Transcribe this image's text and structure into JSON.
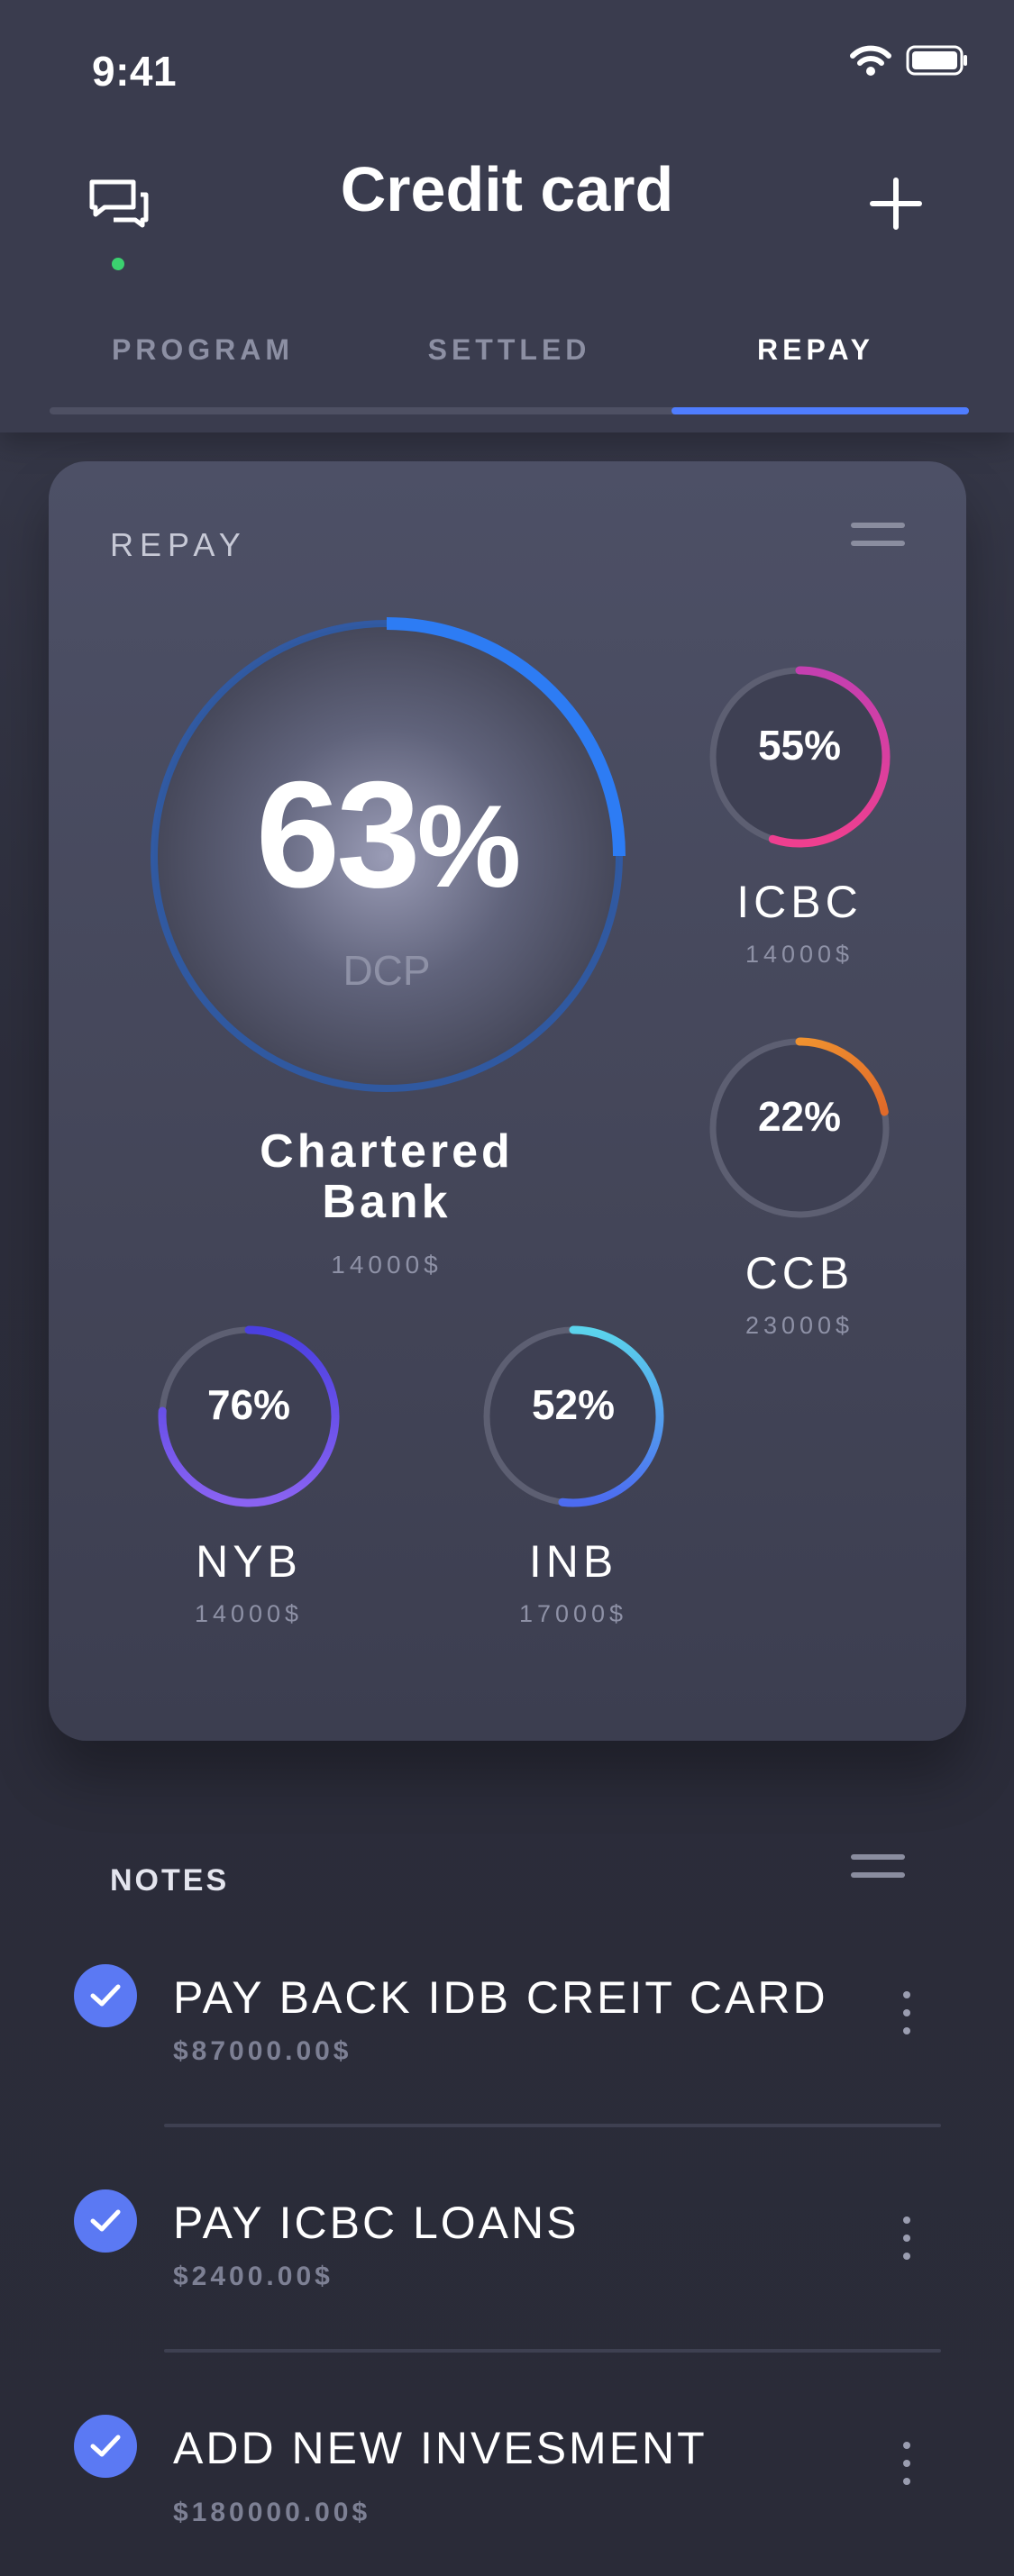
{
  "status_bar": {
    "time": "9:41"
  },
  "header": {
    "title": "Credit card"
  },
  "tabs": [
    {
      "label": "PROGRAM",
      "active": false
    },
    {
      "label": "SETTLED",
      "active": false
    },
    {
      "label": "REPAY",
      "active": true
    }
  ],
  "card": {
    "title": "REPAY",
    "main": {
      "value": "63",
      "unit": "%",
      "label": "DCP",
      "bank": "Chartered Bank",
      "bank_line1": "Chartered",
      "bank_line2": "Bank",
      "amount": "14000$",
      "progress": 0.63,
      "color": "#2d7cf4"
    },
    "items": [
      {
        "value": "55%",
        "name": "ICBC",
        "amount": "14000$",
        "progress": 0.55,
        "color_start": "#c43fb0",
        "color_end": "#ee3f8f"
      },
      {
        "value": "22%",
        "name": "CCB",
        "amount": "23000$",
        "progress": 0.22,
        "color_start": "#f0922f",
        "color_end": "#e06a2a"
      },
      {
        "value": "76%",
        "name": "NYB",
        "amount": "14000$",
        "progress": 0.76,
        "color_start": "#4a3fe0",
        "color_end": "#8a63f2"
      },
      {
        "value": "52%",
        "name": "INB",
        "amount": "17000$",
        "progress": 0.52,
        "color_start": "#5bd4ec",
        "color_end": "#4c6bf0"
      }
    ]
  },
  "notes": {
    "title": "NOTES",
    "items": [
      {
        "title": "PAY BACK IDB CREIT CARD",
        "amount": "$87000.00$"
      },
      {
        "title": "PAY ICBC LOANS",
        "amount": "$2400.00$"
      },
      {
        "title": "ADD NEW INVESMENT",
        "amount": "$180000.00$"
      }
    ]
  },
  "colors": {
    "accent": "#4f7dff",
    "check": "#5b79f3",
    "online": "#3bd16f"
  },
  "icons": [
    "chat-icon",
    "plus-icon",
    "wifi-icon",
    "battery-icon",
    "menu-icon",
    "check-icon",
    "more-vertical-icon"
  ]
}
